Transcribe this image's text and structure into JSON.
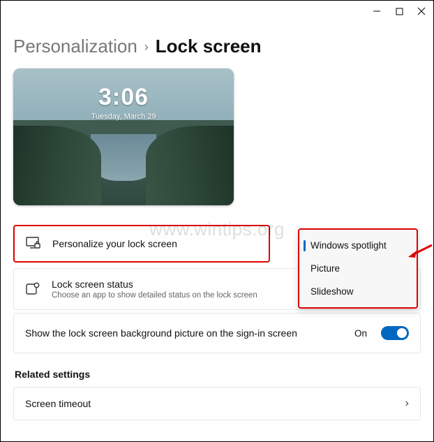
{
  "window": {
    "minimize": "—",
    "maximize": "▢",
    "close": "✕"
  },
  "breadcrumb": {
    "parent": "Personalization",
    "separator": "›",
    "current": "Lock screen"
  },
  "preview": {
    "time": "3:06",
    "date": "Tuesday, March 29"
  },
  "watermark": "www.wintips.org",
  "settings": {
    "personalize_label": "Personalize your lock screen",
    "status_title": "Lock screen status",
    "status_sub": "Choose an app to show detailed status on the lock screen",
    "show_bg_label": "Show the lock screen background picture on the sign-in screen",
    "show_bg_state": "On"
  },
  "dropdown": {
    "items": [
      {
        "label": "Windows spotlight",
        "selected": true
      },
      {
        "label": "Picture",
        "selected": false
      },
      {
        "label": "Slideshow",
        "selected": false
      }
    ]
  },
  "related": {
    "heading": "Related settings",
    "timeout_label": "Screen timeout"
  }
}
